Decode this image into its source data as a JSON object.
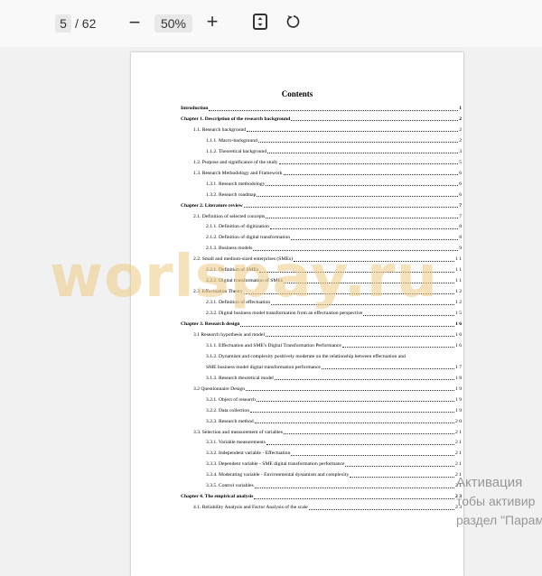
{
  "toolbar": {
    "current_page": "5",
    "total_pages": "/ 62",
    "zoom_out_symbol": "−",
    "zoom_level": "50%",
    "zoom_in_symbol": "+"
  },
  "document": {
    "title": "Contents",
    "continuation_line": "SME business model digital transformation performance"
  },
  "toc": [
    {
      "text": "Introduction",
      "page": "1",
      "level": 0,
      "bold": true
    },
    {
      "text": "Chapter 1. Description of the research background",
      "page": "2",
      "level": 0,
      "bold": true
    },
    {
      "text": "1.1. Research background",
      "page": "2",
      "level": 1,
      "bold": false
    },
    {
      "text": "1.1.1. Macro-background",
      "page": "2",
      "level": 2,
      "bold": false
    },
    {
      "text": "1.1.2. Theoretical background",
      "page": "3",
      "level": 2,
      "bold": false
    },
    {
      "text": "1.2. Purpose and significance of the study",
      "page": "5",
      "level": 1,
      "bold": false
    },
    {
      "text": "1.3. Research Methodology and Framework",
      "page": "6",
      "level": 1,
      "bold": false
    },
    {
      "text": "1.3.1. Research methodology",
      "page": "6",
      "level": 2,
      "bold": false
    },
    {
      "text": "1.3.2. Research roadmap",
      "page": "6",
      "level": 2,
      "bold": false
    },
    {
      "text": "Chapter 2. Literature review",
      "page": "7",
      "level": 0,
      "bold": true
    },
    {
      "text": "2.1. Definition of selected concepts",
      "page": "7",
      "level": 1,
      "bold": false
    },
    {
      "text": "2.1.1. Definition of digitization",
      "page": "8",
      "level": 2,
      "bold": false
    },
    {
      "text": "2.1.2. Definition of digital transformation",
      "page": "8",
      "level": 2,
      "bold": false
    },
    {
      "text": "2.1.3. Business models",
      "page": "9",
      "level": 2,
      "bold": false
    },
    {
      "text": "2.2. Small and medium-sized enterprises (SMEs)",
      "page": "1 1",
      "level": 1,
      "bold": false
    },
    {
      "text": "2.2.1. Definition of SMEs",
      "page": "1 1",
      "level": 2,
      "bold": false
    },
    {
      "text": "2.2.2. Digital transformation of SMEs",
      "page": "1 1",
      "level": 2,
      "bold": false
    },
    {
      "text": "2.3. Effectuation Theory",
      "page": "1 2",
      "level": 1,
      "bold": false
    },
    {
      "text": "2.3.1. Definition of effectuation",
      "page": "1 2",
      "level": 2,
      "bold": false
    },
    {
      "text": "2.3.2. Digital business model transformation from an effectuation perspective",
      "page": "1 5",
      "level": 2,
      "bold": false
    },
    {
      "text": "Chapter 3. Research design",
      "page": "1 6",
      "level": 0,
      "bold": true
    },
    {
      "text": "3.1 Research hypothesis and model",
      "page": "1 6",
      "level": 1,
      "bold": false
    },
    {
      "text": "3.1.1. Effectuation and SME's Digital Transformation Performance",
      "page": "1 6",
      "level": 2,
      "bold": false
    },
    {
      "text": "3.1.2. Dynamism and complexity positively moderate on the relationship between effectuation and",
      "page": "",
      "level": 2,
      "bold": false
    },
    {
      "text": "SME business model digital transformation performance",
      "page": "1 7",
      "level": 2,
      "bold": false
    },
    {
      "text": "3.1.3. Research theoretical model",
      "page": "1 8",
      "level": 2,
      "bold": false
    },
    {
      "text": "3.2 Questionnaire Design",
      "page": "1 9",
      "level": 1,
      "bold": false
    },
    {
      "text": "3.2.1. Object of research",
      "page": "1 9",
      "level": 2,
      "bold": false
    },
    {
      "text": "3.2.2. Data collection",
      "page": "1 9",
      "level": 2,
      "bold": false
    },
    {
      "text": "3.2.3. Research method",
      "page": "2 0",
      "level": 2,
      "bold": false
    },
    {
      "text": "3.3. Selection and measurement of variables",
      "page": "2 1",
      "level": 1,
      "bold": false
    },
    {
      "text": "3.3.1. Variable measurements",
      "page": "2 1",
      "level": 2,
      "bold": false
    },
    {
      "text": "3.3.2. Independent variable - Effectuation",
      "page": "2 1",
      "level": 2,
      "bold": false
    },
    {
      "text": "3.3.3. Dependent variable - SME digital transformation performance",
      "page": "2 1",
      "level": 2,
      "bold": false
    },
    {
      "text": "3.3.4. Moderating variable - Environmental dynamism and complexity",
      "page": "2 1",
      "level": 2,
      "bold": false
    },
    {
      "text": "3.3.5. Control variables",
      "page": "2 1",
      "level": 2,
      "bold": false
    },
    {
      "text": "Chapter 4. The empirical analysis",
      "page": "2 3",
      "level": 0,
      "bold": true
    },
    {
      "text": "4.1. Reliability Analysis and Factor Analysis of the scale",
      "page": "2 3",
      "level": 1,
      "bold": false
    }
  ],
  "watermark": "worlspay.ru",
  "activation": {
    "line1": "Активация",
    "line2": "тобы активир",
    "line3": "раздел \"Парам"
  }
}
